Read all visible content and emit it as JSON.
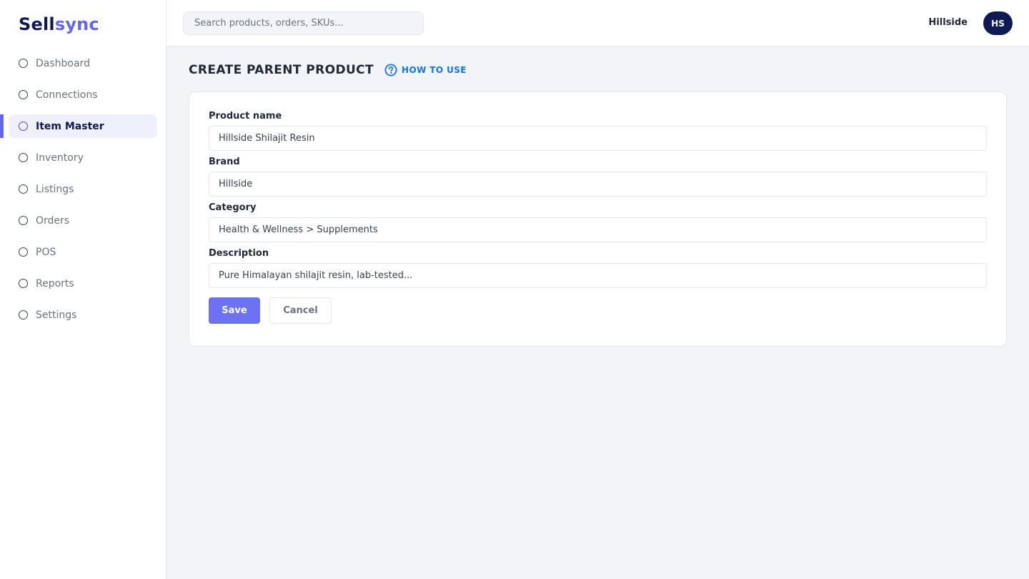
{
  "brand": {
    "part1": "Sell",
    "part2": "sync"
  },
  "search": {
    "placeholder": "Search products, orders, SKUs..."
  },
  "user": {
    "org_name": "Hillside",
    "initials": "HS"
  },
  "sidebar": {
    "items": [
      {
        "label": "Dashboard",
        "icon": "circle-icon",
        "active": false
      },
      {
        "label": "Connections",
        "icon": "circle-icon",
        "active": false
      },
      {
        "label": "Item Master",
        "icon": "circle-icon",
        "active": true
      },
      {
        "label": "Inventory",
        "icon": "circle-icon",
        "active": false
      },
      {
        "label": "Listings",
        "icon": "circle-icon",
        "active": false
      },
      {
        "label": "Orders",
        "icon": "circle-icon",
        "active": false
      },
      {
        "label": "POS",
        "icon": "circle-icon",
        "active": false
      },
      {
        "label": "Reports",
        "icon": "circle-icon",
        "active": false
      },
      {
        "label": "Settings",
        "icon": "circle-icon",
        "active": false
      }
    ]
  },
  "page": {
    "title": "CREATE PARENT PRODUCT",
    "help_label": "HOW TO USE",
    "help_icon": "question-circle-icon"
  },
  "form": {
    "fields": [
      {
        "label": "Product name",
        "value": "Hillside Shilajit Resin"
      },
      {
        "label": "Brand",
        "value": "Hillside"
      },
      {
        "label": "Category",
        "value": "Health & Wellness > Supplements"
      },
      {
        "label": "Description",
        "value": "Pure Himalayan shilajit resin, lab-tested..."
      }
    ],
    "save_label": "Save",
    "cancel_label": "Cancel"
  },
  "colors": {
    "accent": "#6366f1",
    "brand_dark": "#0f1a54",
    "link": "#0b74f0",
    "background": "#f3f4f8"
  }
}
